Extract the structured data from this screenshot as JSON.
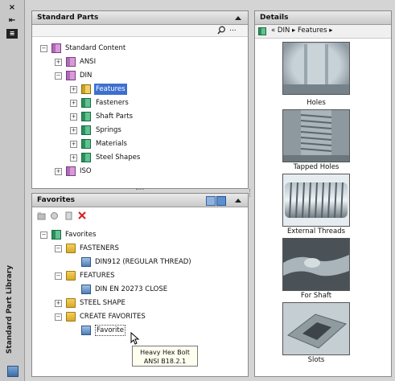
{
  "window": {
    "title": "Standard Part Library"
  },
  "strip": {
    "close": "×",
    "autohide": "⇤",
    "properties": "≡"
  },
  "standard_parts": {
    "title": "Standard Parts",
    "search_icon": "search-icon",
    "more": "...",
    "tree": {
      "root": "Standard Content",
      "ansi": "ANSI",
      "din": "DIN",
      "features": "Features",
      "fasteners": "Fasteners",
      "shaft_parts": "Shaft Parts",
      "springs": "Springs",
      "materials": "Materials",
      "steel_shapes": "Steel Shapes",
      "iso": "ISO"
    }
  },
  "favorites": {
    "title": "Favorites",
    "tree": {
      "root": "Favorites",
      "fasteners": "FASTENERS",
      "din912": "DIN912 (REGULAR THREAD)",
      "features": "FEATURES",
      "din_en": "DIN EN 20273 CLOSE",
      "steel_shape": "STEEL SHAPE",
      "create_favorites": "CREATE FAVORITES",
      "favorite": "Favorite"
    },
    "tooltip": {
      "line1": "Heavy Hex Bolt",
      "line2": "ANSI B18.2.1"
    }
  },
  "details": {
    "title": "Details",
    "breadcrumb": "« DIN ▸ Features ▸",
    "items": [
      "Holes",
      "Tapped Holes",
      "External Threads",
      "For Shaft",
      "Slots"
    ]
  },
  "colors": {
    "selection": "#3d6fcf",
    "delete": "#d42020"
  }
}
